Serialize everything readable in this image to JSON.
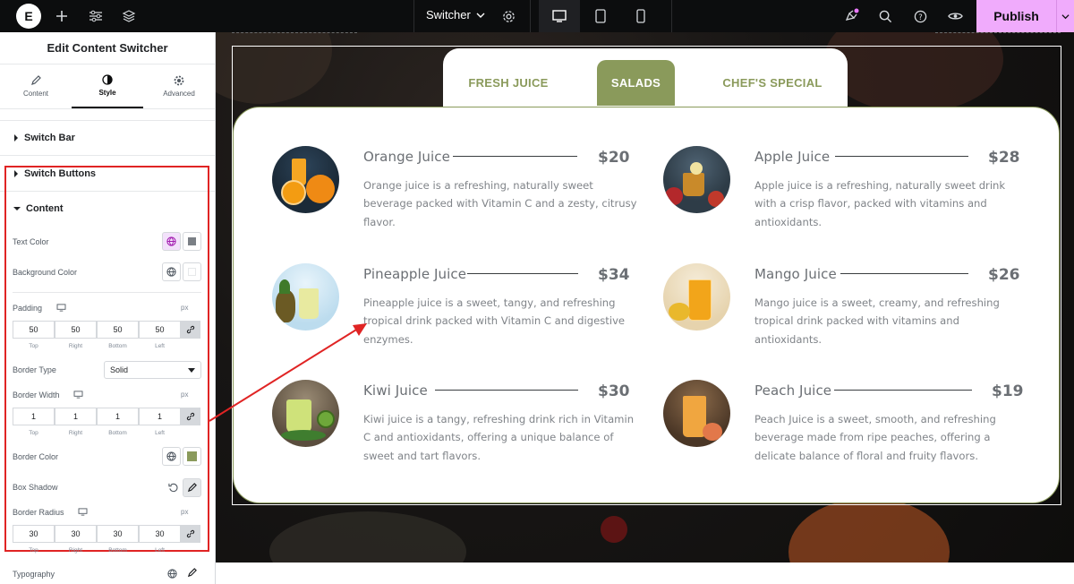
{
  "topbar": {
    "page_name": "Switcher",
    "publish_label": "Publish"
  },
  "panel": {
    "title": "Edit Content Switcher",
    "tabs": [
      {
        "label": "Content",
        "icon": "pencil-icon"
      },
      {
        "label": "Style",
        "icon": "contrast-icon"
      },
      {
        "label": "Advanced",
        "icon": "gear-icon"
      }
    ],
    "sections": {
      "switch_bar": "Switch Bar",
      "switch_buttons": "Switch Buttons",
      "content": "Content"
    },
    "controls": {
      "text_color": "Text Color",
      "background_color": "Background Color",
      "padding": "Padding",
      "border_type": "Border Type",
      "border_type_value": "Solid",
      "border_width": "Border Width",
      "border_color": "Border Color",
      "box_shadow": "Box Shadow",
      "border_radius": "Border Radius",
      "typography": "Typography",
      "unit": "px"
    },
    "padding_values": {
      "top": "50",
      "right": "50",
      "bottom": "50",
      "left": "50"
    },
    "border_width_values": {
      "top": "1",
      "right": "1",
      "bottom": "1",
      "left": "1"
    },
    "border_radius_values": {
      "top": "30",
      "right": "30",
      "bottom": "30",
      "left": "30"
    },
    "dim_labels": {
      "top": "Top",
      "right": "Right",
      "bottom": "Bottom",
      "left": "Left"
    },
    "colors": {
      "text_swatch": "#7a7f85",
      "border_swatch": "#8a9a5b",
      "highlight": "#e02424"
    }
  },
  "switcher": {
    "tabs": [
      "FRESH JUICE",
      "SALADS",
      "CHEF'S SPECIAL"
    ],
    "active_tab": "SALADS",
    "accent": "#8a9a5b"
  },
  "items": [
    {
      "name": "Orange Juice",
      "price": "$20",
      "desc": "Orange juice is a refreshing, naturally sweet beverage packed with Vitamin C and a zesty, citrusy flavor."
    },
    {
      "name": "Apple Juice",
      "price": "$28",
      "desc": "Apple juice is a refreshing, naturally sweet drink with a crisp flavor, packed with vitamins and antioxidants."
    },
    {
      "name": "Pineapple Juice",
      "price": "$34",
      "desc": "Pineapple juice is a sweet, tangy, and refreshing tropical drink packed with Vitamin C and digestive enzymes."
    },
    {
      "name": "Mango Juice",
      "price": "$26",
      "desc": "Mango juice is a sweet, creamy, and refreshing tropical drink packed with vitamins and antioxidants."
    },
    {
      "name": "Kiwi Juice",
      "price": "$30",
      "desc": "Kiwi juice is a tangy, refreshing drink rich in Vitamin C and antioxidants, offering a unique balance of sweet and tart flavors."
    },
    {
      "name": "Peach Juice",
      "price": "$19",
      "desc": "Peach Juice is a sweet, smooth, and refreshing beverage made from ripe peaches, offering a delicate balance of floral and fruity flavors."
    }
  ]
}
